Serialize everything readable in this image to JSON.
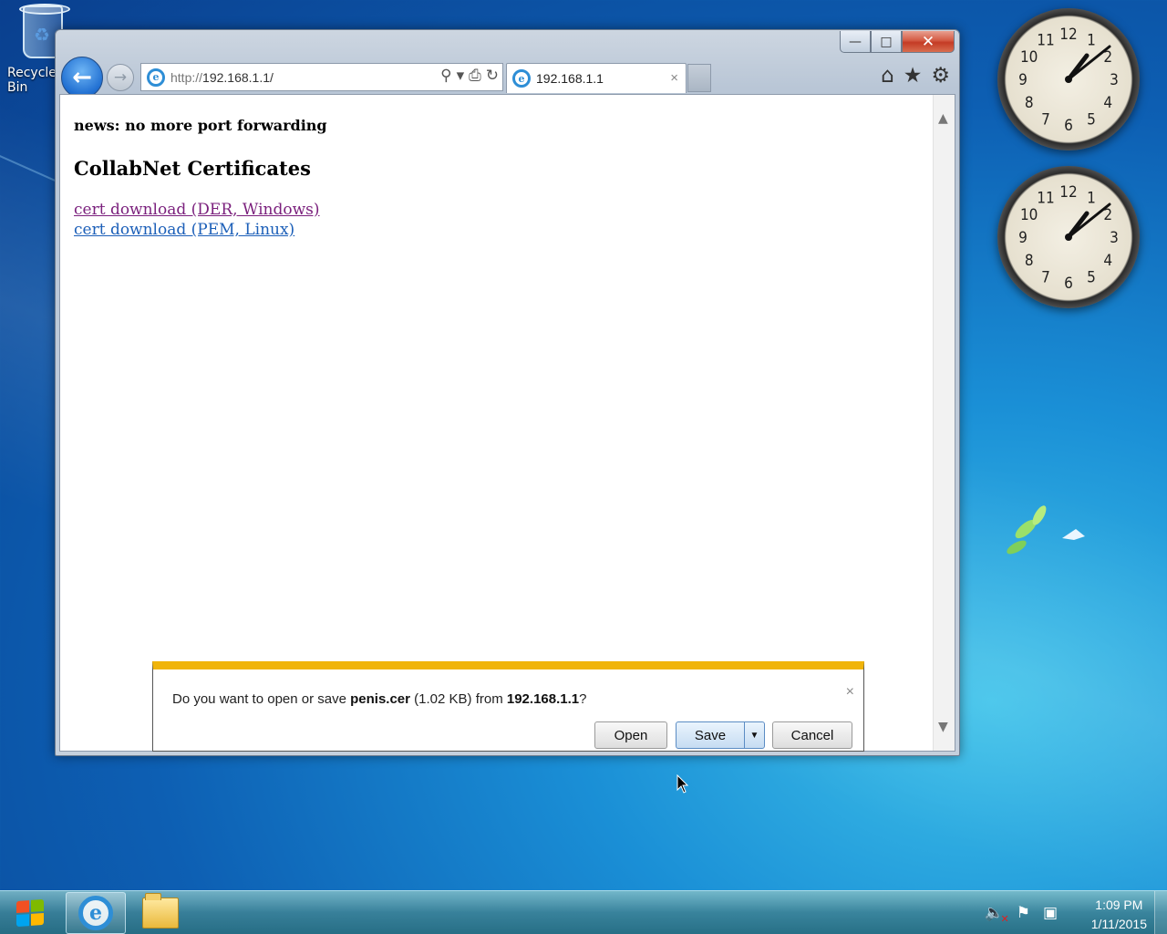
{
  "desktop": {
    "recycle_bin_label": "Recycle Bin",
    "clock_numerals": [
      "12",
      "1",
      "2",
      "3",
      "4",
      "5",
      "6",
      "7",
      "8",
      "9",
      "10",
      "11"
    ],
    "clocks_time": "1:09"
  },
  "browser": {
    "address_protocol": "http://",
    "address_host": "192.168.1.1/",
    "tab_title": "192.168.1.1",
    "tab_close": "×",
    "caption_minimize": "—",
    "caption_maximize": "□",
    "caption_close": "✕"
  },
  "page": {
    "news": "news: no more port forwarding",
    "heading": "CollabNet Certificates",
    "links": [
      "cert download (DER, Windows)",
      "cert download (PEM, Linux)"
    ]
  },
  "download_bar": {
    "prefix": "Do you want to open or save ",
    "filename": "penis.cer",
    "size": " (1.02 KB) from ",
    "host": "192.168.1.1",
    "suffix": "?",
    "open_label": "Open",
    "save_label": "Save",
    "cancel_label": "Cancel",
    "close_glyph": "×"
  },
  "taskbar": {
    "time": "1:09 PM",
    "date": "1/11/2015",
    "items": [
      "internet-explorer",
      "windows-explorer"
    ]
  },
  "icons": {
    "back": "←",
    "forward": "→",
    "search": "⚲",
    "dropdown": "▾",
    "compat": "⎙",
    "refresh": "↻",
    "home": "⌂",
    "favorites": "★",
    "tools": "⚙",
    "scroll_up": "▲",
    "scroll_down": "▼",
    "save_arrow": "▼",
    "tray_volume": "🔈",
    "tray_flag": "⚑",
    "tray_network": "▣"
  },
  "colors": {
    "notify_accent": "#f0b409",
    "visited_link": "#7a1f7c",
    "link": "#1c5fb8",
    "close_button": "#c43b25"
  }
}
